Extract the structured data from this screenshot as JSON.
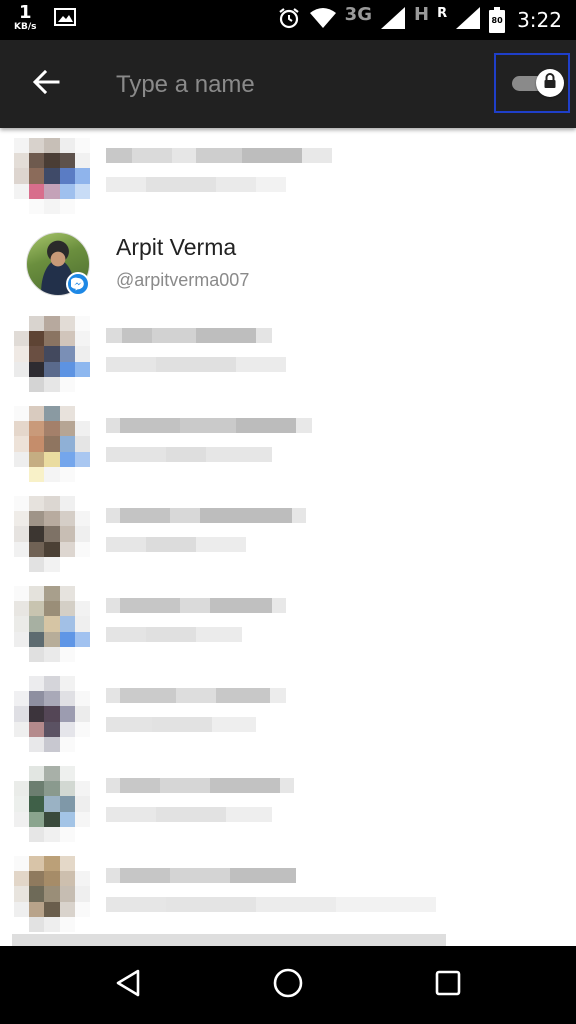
{
  "status_bar": {
    "net_speed_value": "1",
    "net_speed_unit": "KB/s",
    "network_3g": "3G",
    "network_h": "H",
    "roaming": "R",
    "battery_level": "80",
    "time": "3:22",
    "icons": [
      "gallery-icon",
      "alarm-icon",
      "wifi-icon",
      "signal-icon",
      "battery-icon"
    ]
  },
  "app_bar": {
    "back_icon": "arrow-back-icon",
    "search_placeholder": "Type a name",
    "search_value": "",
    "secret_toggle_icon": "lock-icon",
    "secret_toggle_on": true,
    "highlight_color": "#1f3fc9"
  },
  "contact": {
    "name": "Arpit Verma",
    "handle": "@arpitverma007",
    "badge_icon": "messenger-icon",
    "badge_color": "#1e88e5"
  },
  "navigation": {
    "icons": [
      "back-triangle-icon",
      "home-circle-icon",
      "recents-square-icon"
    ]
  },
  "colors": {
    "app_bar": "#212121",
    "status_bar": "#000000",
    "placeholder": "#8a8a8a"
  }
}
